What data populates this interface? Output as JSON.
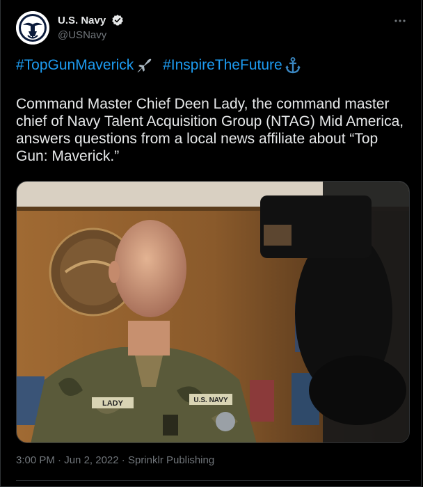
{
  "account": {
    "display_name": "U.S. Navy",
    "handle": "@USNavy",
    "verified": true
  },
  "tweet": {
    "hashtags": [
      "#TopGunMaverick",
      "#InspireTheFuture"
    ],
    "emoji": [
      "fighter-jet-icon",
      "anchor-icon"
    ],
    "text": "Command Master Chief Deen Lady, the command master chief of Navy Talent Acquisition Group (NTAG) Mid America, answers questions from a local news affiliate about “Top Gun: Maverick.”",
    "time": "3:00 PM",
    "date": "Jun 2, 2022",
    "source": "Sprinklr Publishing",
    "separator": " · "
  },
  "photo": {
    "name_tape": "LADY",
    "branch_tape": "U.S. NAVY"
  },
  "colors": {
    "background": "#000000",
    "text": "#e7e9ea",
    "secondary": "#71767b",
    "accent": "#1d9bf0",
    "border": "#2f3336"
  }
}
